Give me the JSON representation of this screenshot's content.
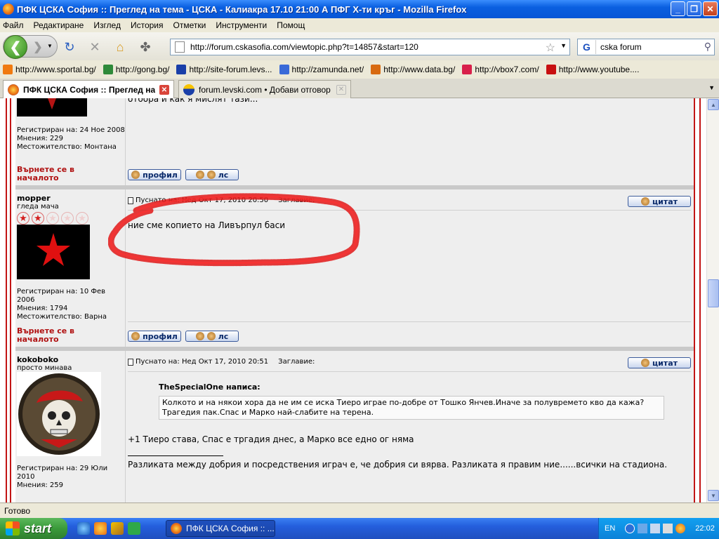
{
  "window": {
    "title": "ПФК ЦСКА София :: Преглед на тема - ЦСКА - Калиакра 17.10 21:00 А ПФГ Х-ти кръг - Mozilla Firefox"
  },
  "menu": [
    "Файл",
    "Редактиране",
    "Изглед",
    "История",
    "Отметки",
    "Инструменти",
    "Помощ"
  ],
  "nav": {
    "url": "http://forum.cskasofia.com/viewtopic.php?t=14857&start=120",
    "search_value": "cska forum"
  },
  "bookmarks": [
    {
      "label": "http://www.sportal.bg/",
      "color": "#f07a10"
    },
    {
      "label": "http://gong.bg/",
      "color": "#2f8a3a"
    },
    {
      "label": "http://site-forum.levs...",
      "color": "#1a3fa8"
    },
    {
      "label": "http://zamunda.net/",
      "color": "#3a6ad8"
    },
    {
      "label": "http://www.data.bg/",
      "color": "#d86a10"
    },
    {
      "label": "http://vbox7.com/",
      "color": "#d8204a"
    },
    {
      "label": "http://www.youtube....",
      "color": "#c81010"
    }
  ],
  "tabs": [
    {
      "label": "ПФК ЦСКА София :: Преглед на т...",
      "active": true
    },
    {
      "label": "forum.levski.com • Добави отговор",
      "active": false
    }
  ],
  "posts": [
    {
      "partial_text": "отбора и как я мислят тази...",
      "registered": "Регистриран на: 24 Ное 2008",
      "messages": "Мнения: 229",
      "location": "Местожителство: Монтана",
      "back_top": "Върнете се в началото"
    },
    {
      "username": "mopper",
      "rank": "гледа мача",
      "stars": 2,
      "posted": "Пуснато на: Нед Окт 17, 2010 20:50",
      "subject_label": "Заглавие:",
      "text": "ние сме копието на Ливърпул баси",
      "registered": "Регистриран на: 10 Фев 2006",
      "messages": "Мнения: 1794",
      "location": "Местожителство: Варна",
      "back_top": "Върнете се в началото"
    },
    {
      "username": "kokoboko",
      "rank": "просто минава",
      "posted": "Пуснато на: Нед Окт 17, 2010 20:51",
      "subject_label": "Заглавие:",
      "quote_author": "TheSpecialOne написа:",
      "quote_text": "Колкото и на някои хора да не им се иска Тиеро играе по-добре от Тошко Янчев.Иначе за полувремето кво да кажа? Трагедия пак.Спас и Марко най-слабите на терена.",
      "text": "+1 Тиеро става, Спас е тргадия днес, а Марко все едно ог няма",
      "signature": "Разликата между добрия и посредствения играч е, че добрия си вярва. Разликата я правим ние......всички на стадиона.",
      "registered": "Регистриран на: 29 Юли 2010",
      "messages": "Мнения: 259"
    }
  ],
  "buttons": {
    "profile": "профил",
    "pm": "лс",
    "quote": "цитат"
  },
  "status": "Готово",
  "taskbar": {
    "start": "start",
    "task": "ПФК ЦСКА София :: ...",
    "lang": "EN",
    "clock": "22:02"
  }
}
